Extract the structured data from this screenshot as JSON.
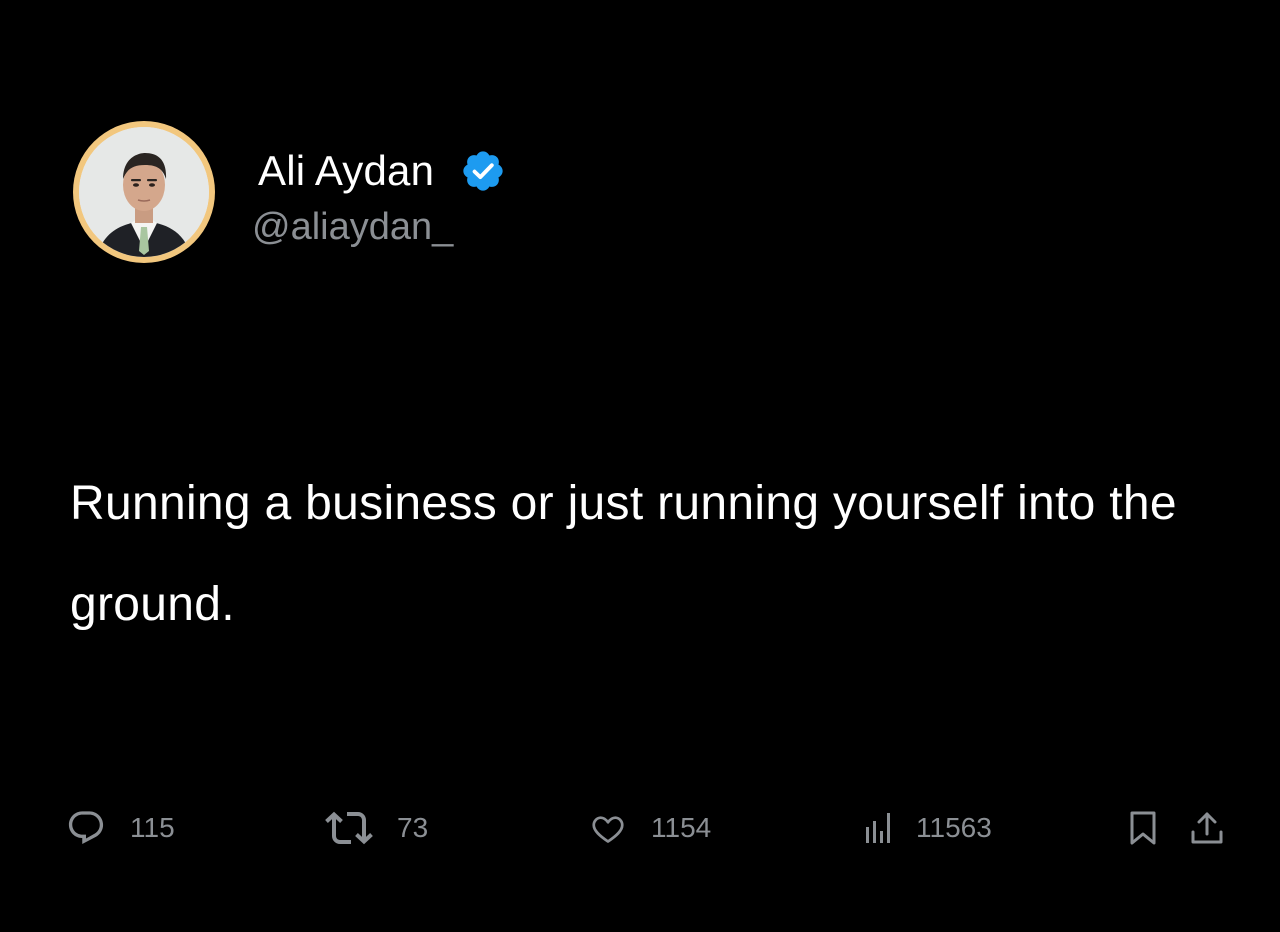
{
  "author": {
    "display_name": "Ali Aydan",
    "handle": "@aliaydan_",
    "verified": true,
    "avatar_ring_color": "#f2c77e",
    "verified_badge_color": "#1d9bf0"
  },
  "tweet": {
    "text": "Running a business or just running yourself into the ground."
  },
  "actions": {
    "replies": "115",
    "retweets": "73",
    "likes": "1154",
    "views": "11563"
  },
  "icons": {
    "reply": "speech-bubble-icon",
    "retweet": "retweet-icon",
    "like": "heart-icon",
    "views": "bar-chart-icon",
    "bookmark": "bookmark-icon",
    "share": "share-upload-icon"
  }
}
